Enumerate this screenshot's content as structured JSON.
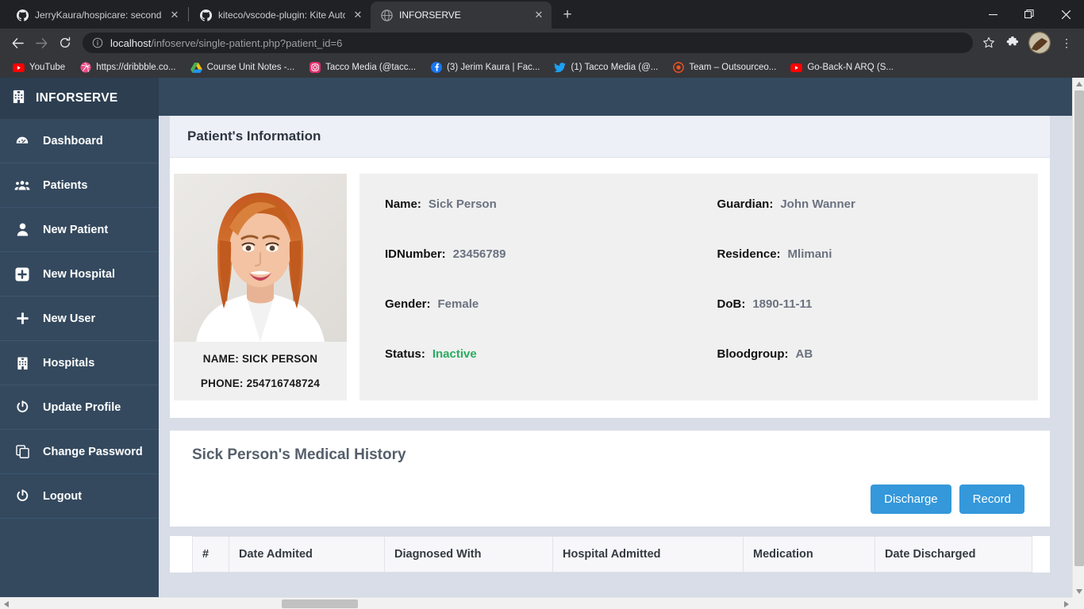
{
  "browser": {
    "tabs": [
      {
        "title": "JerryKaura/hospicare: second yea",
        "favicon": "github-icon",
        "active": false
      },
      {
        "title": "kiteco/vscode-plugin: Kite Autoc",
        "favicon": "github-icon",
        "active": false
      },
      {
        "title": "INFORSERVE",
        "favicon": "globe-icon",
        "active": true
      }
    ],
    "new_tab_label": "+",
    "close_label": "✕",
    "window_controls": {
      "minimize": "—",
      "maximize": "❐",
      "close": "✕"
    },
    "nav": {
      "back": "←",
      "forward": "→",
      "reload": "⟳"
    },
    "omnibox": {
      "info_icon": "ⓘ",
      "url_host": "localhost",
      "url_path": "/infoserve/single-patient.php?patient_id=6"
    },
    "toolbar_icons": {
      "bookmark_star": "☆",
      "extensions": "puzzle-icon",
      "menu": "⋮"
    },
    "bookmarks": [
      {
        "label": "YouTube",
        "icon": "youtube-icon"
      },
      {
        "label": "https://dribbble.co...",
        "icon": "dribbble-icon"
      },
      {
        "label": "Course Unit Notes -...",
        "icon": "google-drive-icon"
      },
      {
        "label": "Tacco Media (@tacc...",
        "icon": "instagram-icon"
      },
      {
        "label": "(3) Jerim Kaura | Fac...",
        "icon": "facebook-icon"
      },
      {
        "label": "(1) Tacco Media (@...",
        "icon": "twitter-icon"
      },
      {
        "label": "Team – Outsourceo...",
        "icon": "target-icon"
      },
      {
        "label": "Go-Back-N ARQ (S...",
        "icon": "youtube-icon"
      }
    ]
  },
  "app": {
    "brand": {
      "name": "INFORSERVE",
      "icon": "hospital-icon"
    },
    "sidebar": {
      "items": [
        {
          "label": "Dashboard",
          "icon": "dashboard-icon"
        },
        {
          "label": "Patients",
          "icon": "users-icon"
        },
        {
          "label": "New Patient",
          "icon": "user-icon"
        },
        {
          "label": "New Hospital",
          "icon": "plus-square-icon"
        },
        {
          "label": "New User",
          "icon": "plus-icon"
        },
        {
          "label": "Hospitals",
          "icon": "hospital-icon"
        },
        {
          "label": "Update Profile",
          "icon": "power-icon"
        },
        {
          "label": "Change Password",
          "icon": "copy-icon"
        },
        {
          "label": "Logout",
          "icon": "power-icon"
        }
      ]
    },
    "patient_panel": {
      "title": "Patient's Information",
      "photo_caption_name": "NAME: SICK PERSON",
      "photo_caption_phone": "PHONE: 254716748724",
      "fields_left": [
        {
          "label": "Name:",
          "value": "Sick Person"
        },
        {
          "label": "IDNumber:",
          "value": "23456789"
        },
        {
          "label": "Gender:",
          "value": "Female"
        },
        {
          "label": "Status:",
          "value": "Inactive"
        }
      ],
      "fields_right": [
        {
          "label": "Guardian:",
          "value": "John Wanner"
        },
        {
          "label": "Residence:",
          "value": "Mlimani"
        },
        {
          "label": "DoB:",
          "value": "1890-11-11"
        },
        {
          "label": "Bloodgroup:",
          "value": "AB"
        }
      ],
      "status_color": "#27ae60"
    },
    "history": {
      "title": "Sick Person's Medical History",
      "buttons": [
        {
          "label": "Discharge",
          "color": "#3498db"
        },
        {
          "label": "Record",
          "color": "#3498db"
        }
      ],
      "table_headers": [
        "#",
        "Date Admited",
        "Diagnosed With",
        "Hospital Admitted",
        "Medication",
        "Date Discharged"
      ],
      "rows": []
    },
    "colors": {
      "sidebar": "#34495e",
      "brand_bar": "#2c3e50",
      "accent": "#3498db",
      "page_bg": "#d8dde8"
    }
  }
}
